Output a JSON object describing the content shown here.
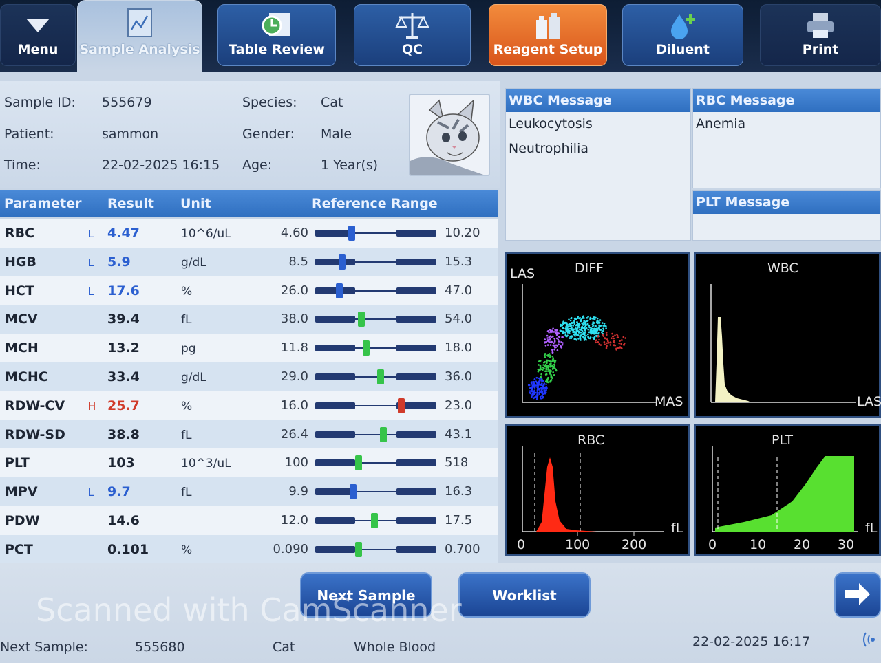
{
  "toolbar": {
    "menu": "Menu",
    "sample_analysis": "Sample Analysis",
    "table_review": "Table Review",
    "qc": "QC",
    "reagent_setup": "Reagent Setup",
    "diluent": "Diluent",
    "print": "Print"
  },
  "sample": {
    "sample_id_label": "Sample ID:",
    "sample_id": "555679",
    "patient_label": "Patient:",
    "patient": "sammon",
    "time_label": "Time:",
    "time": "22-02-2025 16:15",
    "species_label": "Species:",
    "species": "Cat",
    "gender_label": "Gender:",
    "gender": "Male",
    "age_label": "Age:",
    "age": "1 Year(s)"
  },
  "table": {
    "headers": {
      "parameter": "Parameter",
      "result": "Result",
      "unit": "Unit",
      "range": "Reference Range"
    },
    "rows": [
      {
        "name": "RBC",
        "flag": "L",
        "result": "4.47",
        "unit": "10^6/uL",
        "low": "4.60",
        "high": "10.20",
        "marker": 0.3,
        "status": "low"
      },
      {
        "name": "HGB",
        "flag": "L",
        "result": "5.9",
        "unit": "g/dL",
        "low": "8.5",
        "high": "15.3",
        "marker": 0.22,
        "status": "low"
      },
      {
        "name": "HCT",
        "flag": "L",
        "result": "17.6",
        "unit": "%",
        "low": "26.0",
        "high": "47.0",
        "marker": 0.2,
        "status": "low"
      },
      {
        "name": "MCV",
        "flag": "",
        "result": "39.4",
        "unit": "fL",
        "low": "38.0",
        "high": "54.0",
        "marker": 0.38,
        "status": "normal"
      },
      {
        "name": "MCH",
        "flag": "",
        "result": "13.2",
        "unit": "pg",
        "low": "11.8",
        "high": "18.0",
        "marker": 0.42,
        "status": "normal"
      },
      {
        "name": "MCHC",
        "flag": "",
        "result": "33.4",
        "unit": "g/dL",
        "low": "29.0",
        "high": "36.0",
        "marker": 0.54,
        "status": "normal"
      },
      {
        "name": "RDW-CV",
        "flag": "H",
        "result": "25.7",
        "unit": "%",
        "low": "16.0",
        "high": "23.0",
        "marker": 0.71,
        "status": "high"
      },
      {
        "name": "RDW-SD",
        "flag": "",
        "result": "38.8",
        "unit": "fL",
        "low": "26.4",
        "high": "43.1",
        "marker": 0.56,
        "status": "normal"
      },
      {
        "name": "PLT",
        "flag": "",
        "result": "103",
        "unit": "10^3/uL",
        "low": "100",
        "high": "518",
        "marker": 0.36,
        "status": "normal"
      },
      {
        "name": "MPV",
        "flag": "L",
        "result": "9.7",
        "unit": "fL",
        "low": "9.9",
        "high": "16.3",
        "marker": 0.31,
        "status": "low"
      },
      {
        "name": "PDW",
        "flag": "",
        "result": "14.6",
        "unit": "",
        "low": "12.0",
        "high": "17.5",
        "marker": 0.49,
        "status": "normal"
      },
      {
        "name": "PCT",
        "flag": "",
        "result": "0.101",
        "unit": "%",
        "low": "0.090",
        "high": "0.700",
        "marker": 0.36,
        "status": "normal"
      }
    ]
  },
  "messages": {
    "wbc_title": "WBC Message",
    "wbc_lines": [
      "Leukocytosis",
      "Neutrophilia"
    ],
    "rbc_title": "RBC Message",
    "rbc_lines": [
      "Anemia"
    ],
    "plt_title": "PLT Message"
  },
  "graphs": {
    "diff": {
      "title": "DIFF",
      "y_label": "LAS",
      "x_label": "MAS"
    },
    "wbc": {
      "title": "WBC",
      "x_label": "LAS"
    },
    "rbc": {
      "title": "RBC",
      "unit": "fL",
      "ticks": [
        "0",
        "100",
        "200"
      ]
    },
    "plt": {
      "title": "PLT",
      "unit": "fL",
      "ticks": [
        "0",
        "10",
        "20",
        "30"
      ]
    }
  },
  "buttons": {
    "next_sample": "Next Sample",
    "worklist": "Worklist"
  },
  "status": {
    "next_sample_label": "Next Sample:",
    "next_sample_id": "555680",
    "species": "Cat",
    "mode": "Whole Blood",
    "datetime": "22-02-2025 16:17"
  },
  "watermark": "Scanned with CamScanner",
  "colors": {
    "low": "#2b5fd0",
    "high": "#d03b2b",
    "normal_marker": "#36c44a",
    "accent": "#2f6fc0"
  }
}
